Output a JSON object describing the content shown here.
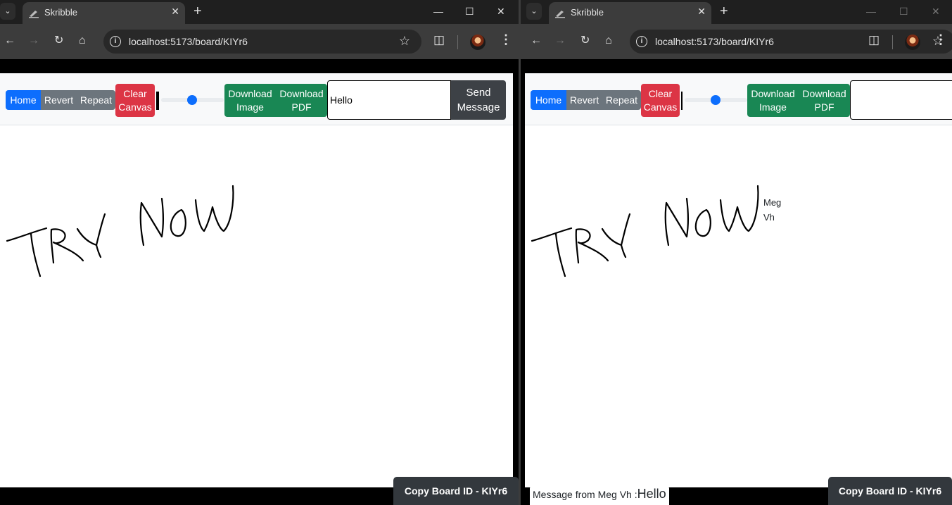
{
  "browser": {
    "tab_title": "Skribble",
    "url": "localhost:5173/board/KIYr6"
  },
  "app": {
    "home": "Home",
    "revert": "Revert",
    "repeat": "Repeat",
    "clear_line1": "Clear",
    "clear_line2": "Canvas",
    "dl_image_line1": "Download",
    "dl_image_line2": "Image",
    "dl_pdf_line1": "Download",
    "dl_pdf_line2": "PDF",
    "send_line1": "Send",
    "send_line2": "Message",
    "copy_board": "Copy Board ID - KIYr6",
    "brush_size_level": 0.5,
    "colors": {
      "primary": "#0d6efd",
      "secondary": "#6c757d",
      "danger": "#dc3545",
      "success": "#198754",
      "dark": "#3d4146"
    }
  },
  "left_window": {
    "message_input_value": "Hello",
    "drawing_text": "TRY NOW"
  },
  "right_window": {
    "message_input_value": "",
    "drawing_text": "TRY NOW",
    "cursor_label_line1": "Meg",
    "cursor_label_line2": "Vh",
    "toast_prefix": "Message from Meg Vh :",
    "toast_message": "Hello"
  },
  "icons": [
    "tab-search-icon",
    "skribble-favicon-icon",
    "close-icon",
    "new-tab-icon",
    "minimize-icon",
    "maximize-icon",
    "back-icon",
    "forward-icon",
    "reload-icon",
    "home-icon",
    "site-info-icon",
    "bookmark-star-icon",
    "extensions-icon",
    "profile-avatar",
    "kebab-menu-icon"
  ]
}
